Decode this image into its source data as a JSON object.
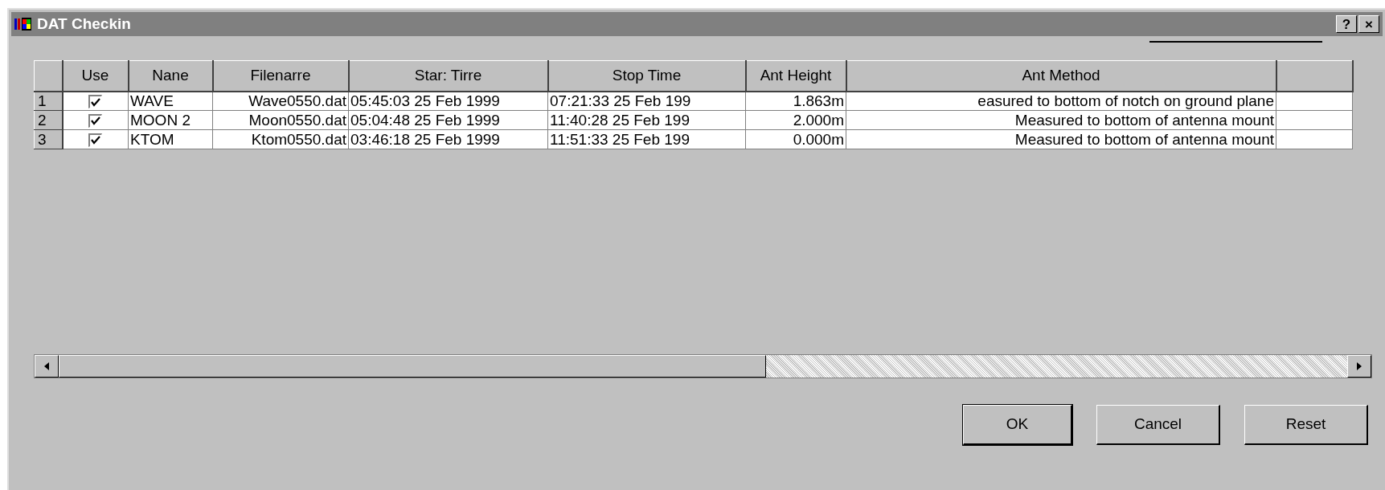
{
  "window": {
    "title": "DAT Checkin",
    "title_buttons": [
      "?",
      "×"
    ]
  },
  "table": {
    "columns": [
      "Use",
      "Nane",
      "Filenarre",
      "Star: Tirre",
      "Stop Time",
      "Ant Height",
      "Ant Method"
    ],
    "rows": [
      {
        "number": "1",
        "use": true,
        "name": "WAVE",
        "filename": "Wave0550.dat",
        "start_time": "05:45:03 25 Feb 1999",
        "stop_time": "07:21:33 25 Feb 199",
        "ant_height": "1.863m",
        "ant_method": "easured to bottom of notch on ground plane"
      },
      {
        "number": "2",
        "use": true,
        "name": "MOON 2",
        "filename": "Moon0550.dat",
        "start_time": "05:04:48 25 Feb 1999",
        "stop_time": "11:40:28 25 Feb 199",
        "ant_height": "2.000m",
        "ant_method": "Measured to bottom of antenna mount"
      },
      {
        "number": "3",
        "use": true,
        "name": "KTOM",
        "filename": "Ktom0550.dat",
        "start_time": "03:46:18 25 Feb 1999",
        "stop_time": "11:51:33 25 Feb 199",
        "ant_height": "0.000m",
        "ant_method": "Measured to bottom of antenna mount"
      }
    ]
  },
  "buttons": [
    "OK",
    "Cancel",
    "Reset"
  ]
}
